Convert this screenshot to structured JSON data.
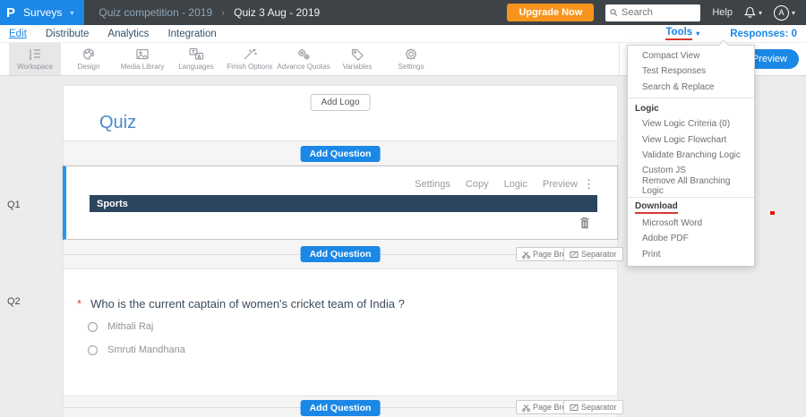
{
  "topbar": {
    "logo_letter": "P",
    "product": "Surveys",
    "breadcrumb": [
      "Quiz competition - 2019",
      "Quiz 3 Aug - 2019"
    ],
    "breadcrumb_separator": "›",
    "upgrade": "Upgrade Now",
    "search_placeholder": "Search",
    "help": "Help",
    "avatar": "A"
  },
  "nav": {
    "tabs": [
      "Edit",
      "Distribute",
      "Analytics",
      "Integration"
    ],
    "active_tab": "Edit",
    "tools": "Tools",
    "responses": "Responses: 0"
  },
  "toolbar": {
    "tabs": [
      "Workspace",
      "Design",
      "Media Library",
      "Languages",
      "Finish Options",
      "Advance Quotas",
      "Variables",
      "Settings"
    ],
    "active_tab": "Workspace",
    "url": "https://",
    "preview": "Preview"
  },
  "builder": {
    "add_logo": "Add Logo",
    "title": "Quiz",
    "add_question": "Add Question",
    "page_break": "Page Break",
    "separator": "Separator",
    "q1": {
      "id": "Q1",
      "heading": "Sports",
      "actions": [
        "Settings",
        "Copy",
        "Logic",
        "Preview"
      ],
      "kebab": "⋮"
    },
    "q2": {
      "id": "Q2",
      "required_marker": "*",
      "text": "Who is the current captain of women's cricket team of India ?",
      "options": [
        "Mithali Raj",
        "Smruti Mandhana"
      ]
    }
  },
  "tools_menu": {
    "sections": [
      {
        "items": [
          "Compact View",
          "Test Responses",
          "Search & Replace"
        ]
      },
      {
        "header": "Logic",
        "items": [
          "View Logic Criteria (0)",
          "View Logic Flowchart",
          "Validate Branching Logic",
          "Custom JS",
          "Remove All Branching Logic"
        ]
      },
      {
        "header": "Download",
        "items": [
          "Microsoft Word",
          "Adobe PDF",
          "Print"
        ]
      }
    ]
  },
  "colors": {
    "brand_blue": "#1b87e6",
    "upgrade_orange": "#f7941d",
    "question_header_navy": "#2b4560",
    "annotation_red": "#d63a2f"
  }
}
